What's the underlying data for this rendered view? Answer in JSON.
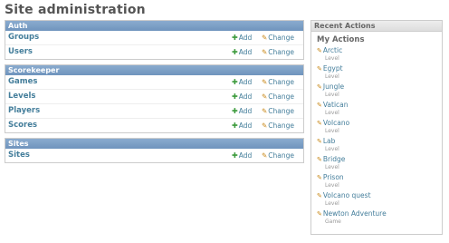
{
  "page": {
    "title": "Site administration"
  },
  "links": {
    "add": "Add",
    "change": "Change"
  },
  "modules": [
    {
      "caption": "Auth",
      "rows": [
        "Groups",
        "Users"
      ]
    },
    {
      "caption": "Scorekeeper",
      "rows": [
        "Games",
        "Levels",
        "Players",
        "Scores"
      ]
    },
    {
      "caption": "Sites",
      "rows": [
        "Sites"
      ]
    }
  ],
  "recent": {
    "caption": "Recent Actions",
    "subtitle": "My Actions",
    "actions": [
      {
        "name": "Arctic",
        "type": "Level"
      },
      {
        "name": "Egypt",
        "type": "Level"
      },
      {
        "name": "Jungle",
        "type": "Level"
      },
      {
        "name": "Vatican",
        "type": "Level"
      },
      {
        "name": "Volcano",
        "type": "Level"
      },
      {
        "name": "Lab",
        "type": "Level"
      },
      {
        "name": "Bridge",
        "type": "Level"
      },
      {
        "name": "Prison",
        "type": "Level"
      },
      {
        "name": "Volcano quest",
        "type": "Level"
      },
      {
        "name": "Newton Adventure",
        "type": "Game"
      }
    ]
  },
  "colors": {
    "caption_bg": "#7ca0c7",
    "link": "#447e9b",
    "add_icon": "#3b9a3b",
    "change_icon": "#c98a1c"
  },
  "icons": {
    "add": "plus-icon",
    "change": "pencil-icon"
  }
}
